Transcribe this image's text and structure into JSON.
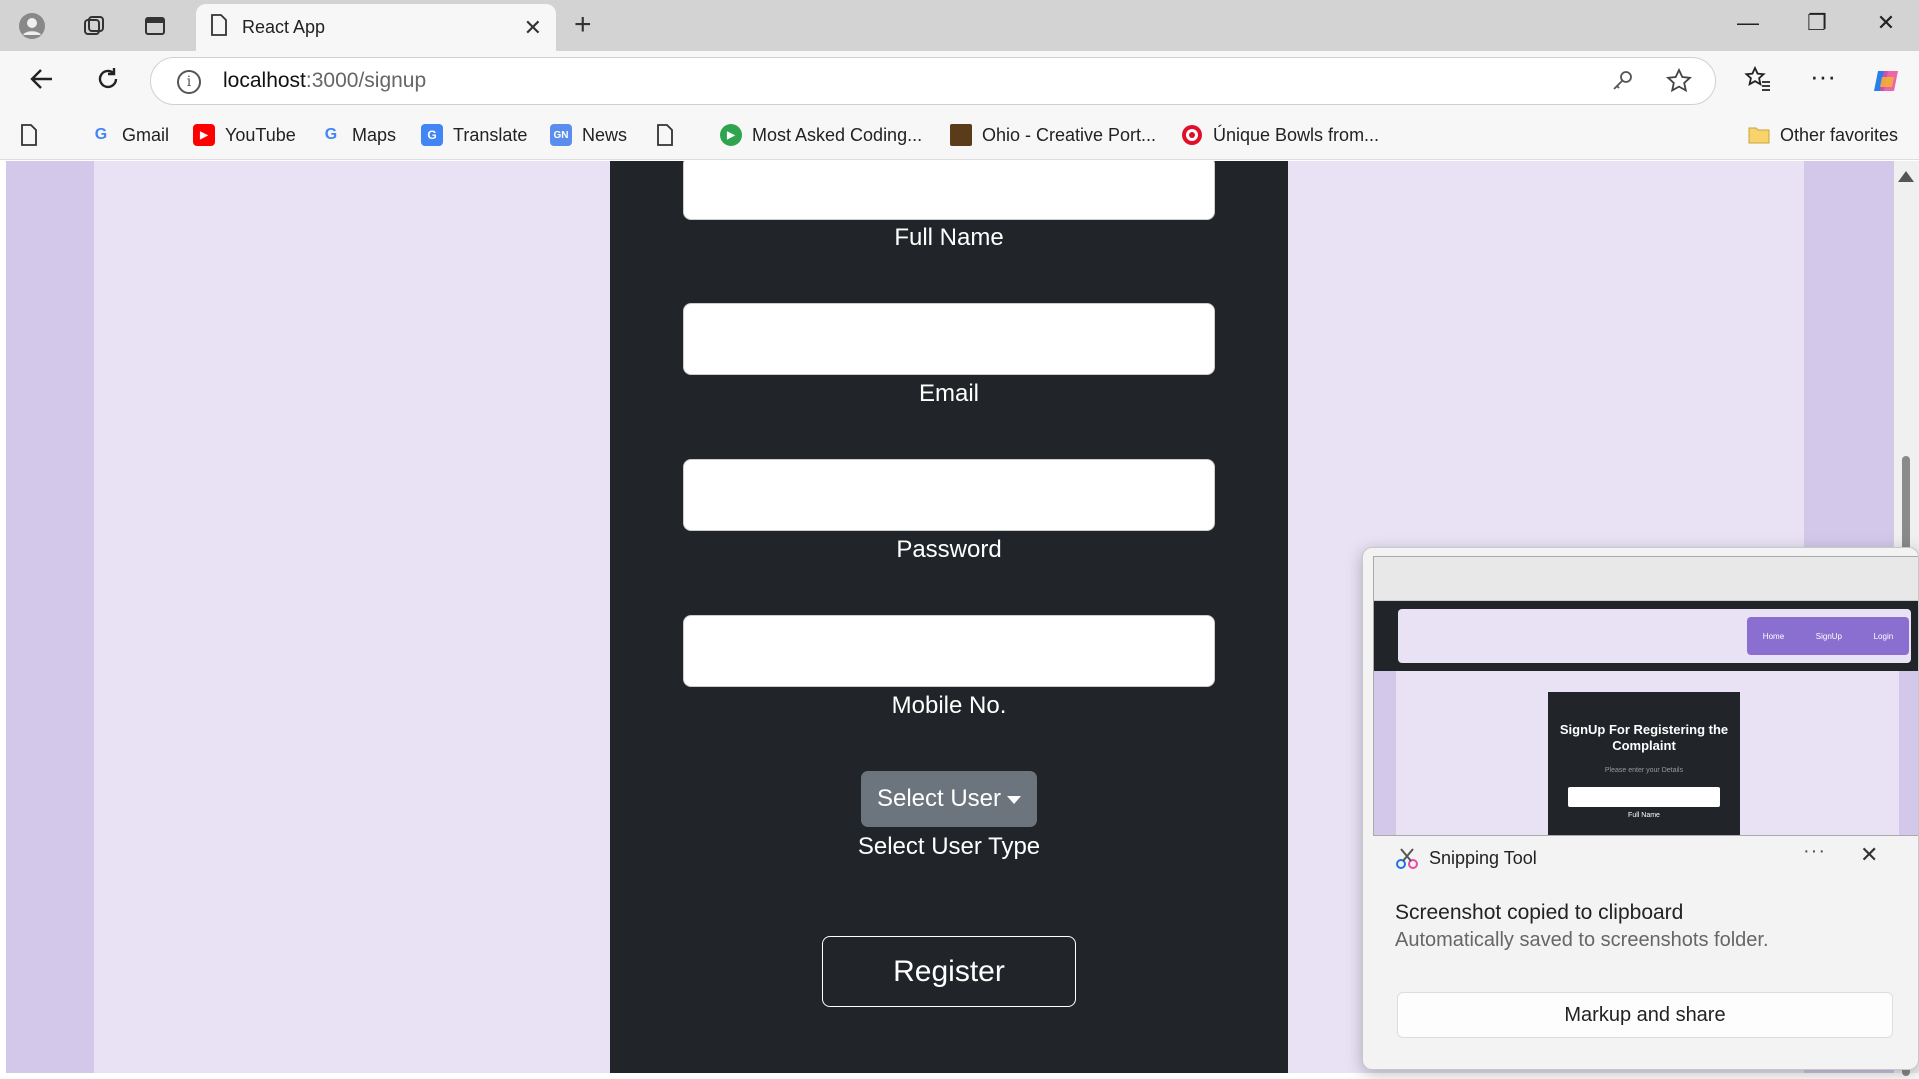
{
  "browser": {
    "tab_title": "React App",
    "url_host": "localhost",
    "url_path": ":3000/signup",
    "bookmarks": [
      {
        "label": "Gmail",
        "icon": "google-icon"
      },
      {
        "label": "YouTube",
        "icon": "youtube-icon"
      },
      {
        "label": "Maps",
        "icon": "google-icon"
      },
      {
        "label": "Translate",
        "icon": "translate-icon"
      },
      {
        "label": "News",
        "icon": "news-icon"
      },
      {
        "label": "",
        "icon": "page-icon"
      },
      {
        "label": "Most Asked Coding...",
        "icon": "shield-icon"
      },
      {
        "label": "Ohio - Creative Port...",
        "icon": "portfolio-icon"
      },
      {
        "label": "Únique Bowls from...",
        "icon": "target-icon"
      }
    ],
    "other_favorites": "Other favorites"
  },
  "form": {
    "fields": [
      {
        "label": "Full Name",
        "value": ""
      },
      {
        "label": "Email",
        "value": ""
      },
      {
        "label": "Password",
        "value": ""
      },
      {
        "label": "Mobile No.",
        "value": ""
      }
    ],
    "select_button": "Select User",
    "select_label": "Select User Type",
    "register_button": "Register"
  },
  "thumbnail": {
    "card_title": "SignUp For Registering the Complaint",
    "card_subtitle": "Please enter your Details",
    "nav_links": [
      "Home",
      "SignUp",
      "Login"
    ],
    "first_label": "Full Name"
  },
  "toast": {
    "app_name": "Snipping Tool",
    "heading": "Screenshot copied to clipboard",
    "subtext": "Automatically saved to screenshots folder.",
    "button": "Markup and share",
    "more": "···"
  },
  "colors": {
    "page_bg": "#e8e2f4",
    "side_bg": "#d3c8ea",
    "panel_bg": "#212529",
    "select_button_bg": "#6c757d"
  }
}
